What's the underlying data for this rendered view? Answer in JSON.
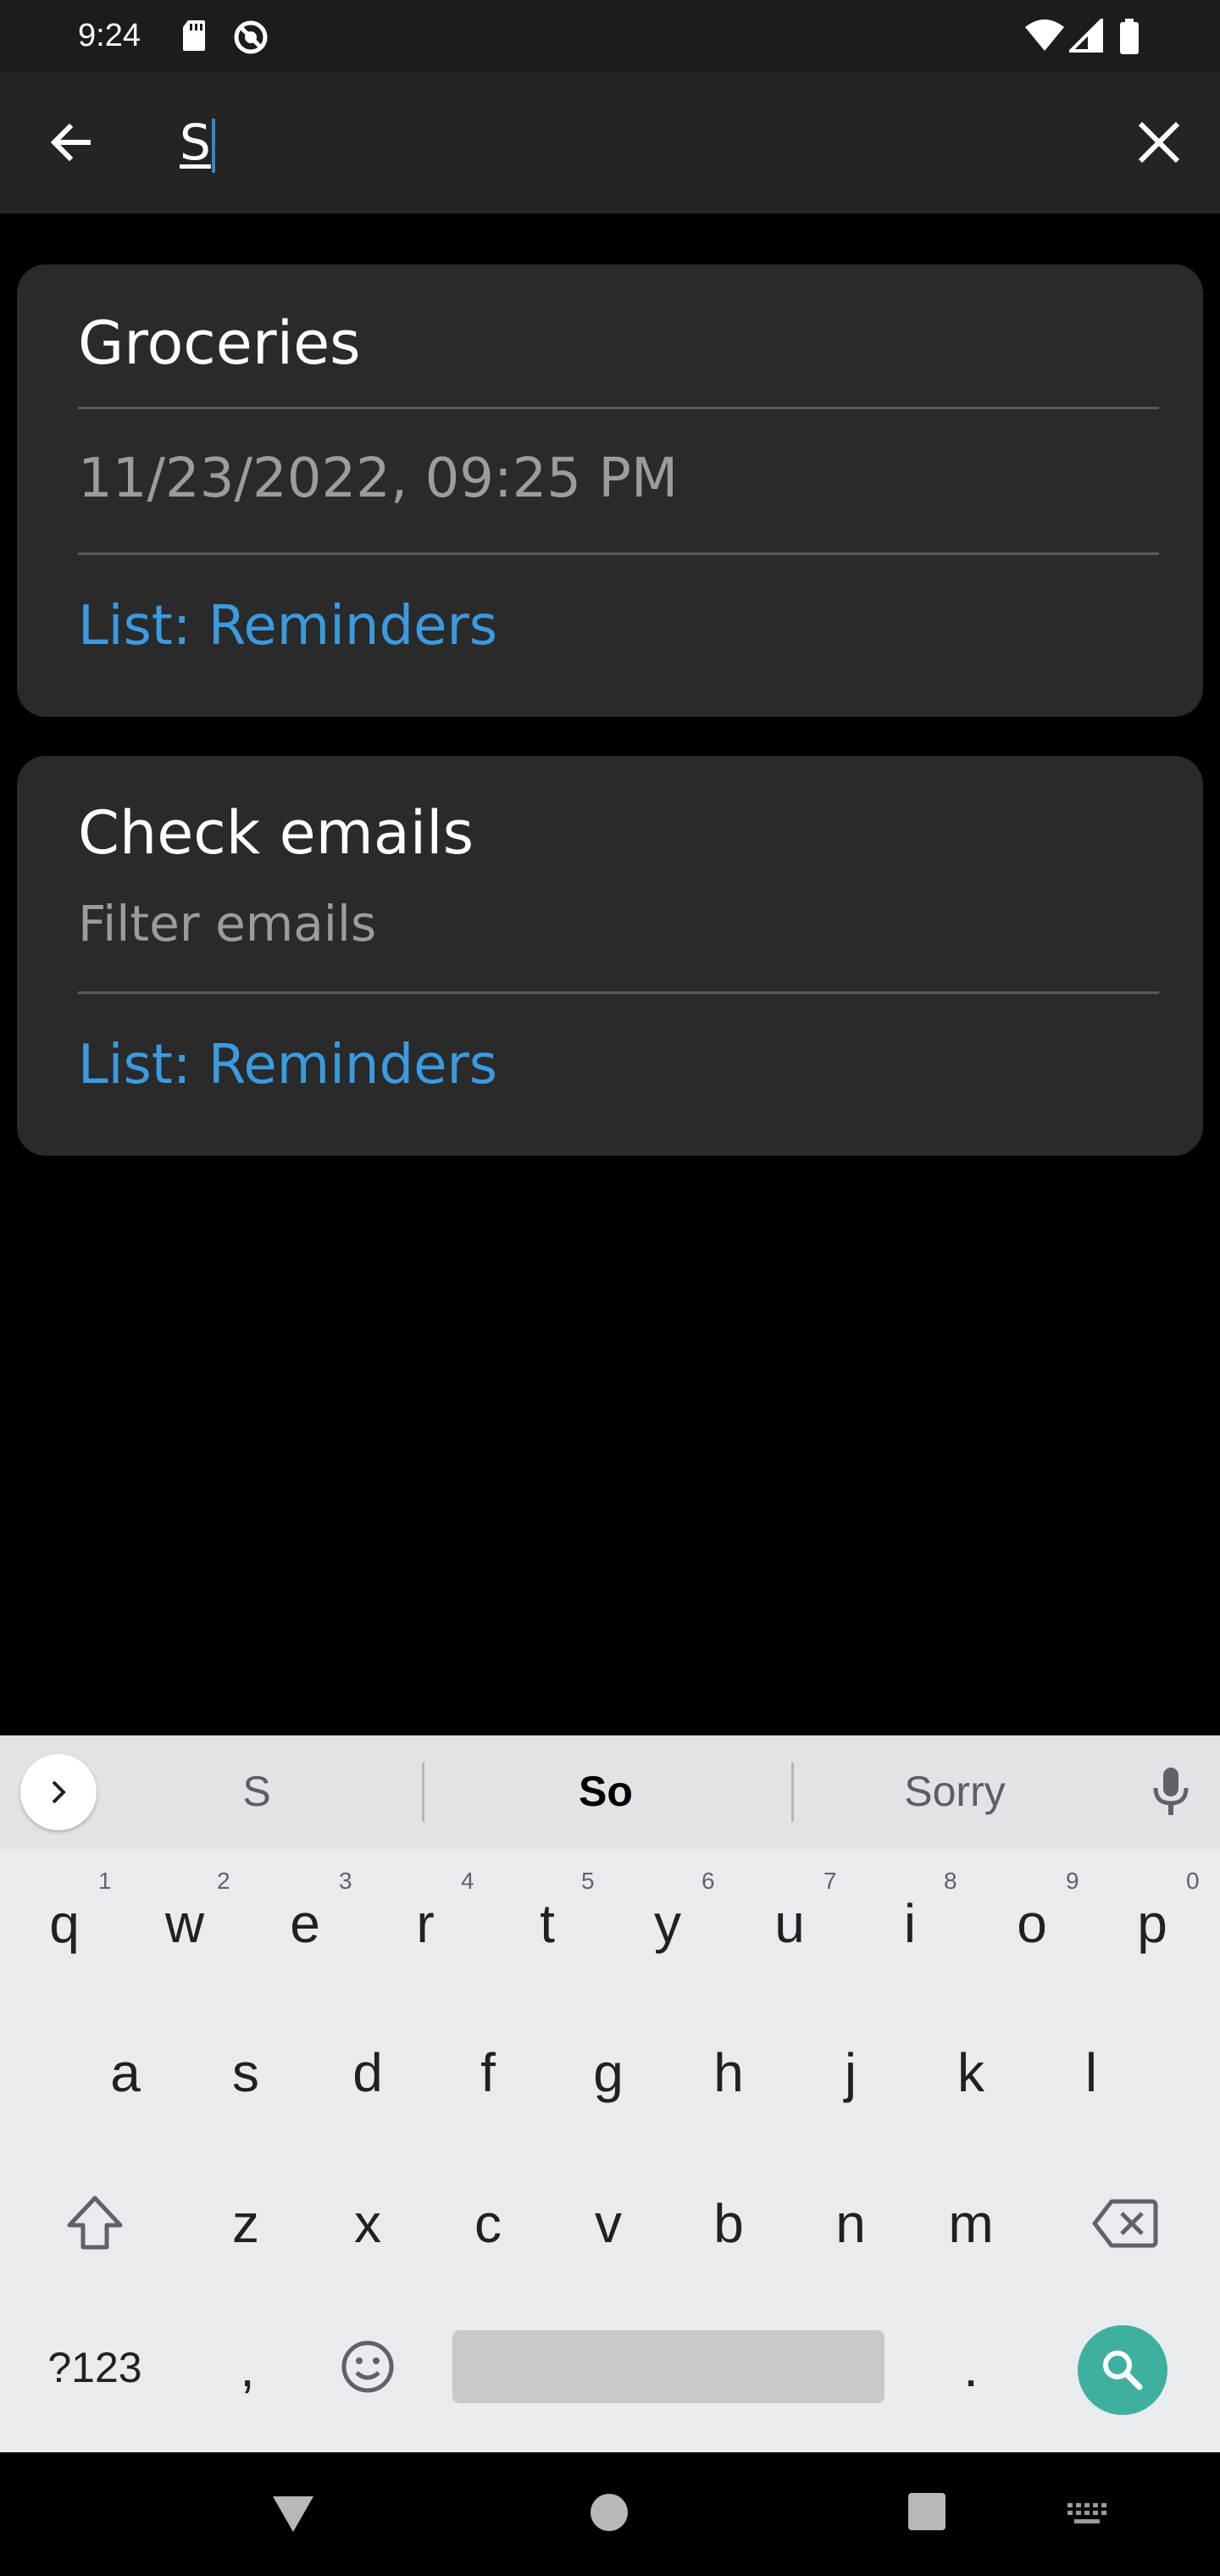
{
  "status": {
    "time": "9:24",
    "left_icons": [
      "sd-card-icon",
      "vpn-circle-icon"
    ],
    "right_icons": [
      "wifi-icon",
      "signal-icon",
      "battery-icon"
    ]
  },
  "search": {
    "value": "S",
    "back_icon": "arrow-left-icon",
    "clear_icon": "close-icon"
  },
  "results": [
    {
      "title": "Groceries",
      "date": "11/23/2022, 09:25 PM",
      "list": "List: Reminders"
    },
    {
      "title": "Check emails",
      "subtitle": "Filter emails",
      "list": "List: Reminders"
    }
  ],
  "keyboard": {
    "suggestions": [
      "S",
      "So",
      "Sorry"
    ],
    "row1": [
      "q",
      "w",
      "e",
      "r",
      "t",
      "y",
      "u",
      "i",
      "o",
      "p"
    ],
    "row1_hints": [
      "1",
      "2",
      "3",
      "4",
      "5",
      "6",
      "7",
      "8",
      "9",
      "0"
    ],
    "row2": [
      "a",
      "s",
      "d",
      "f",
      "g",
      "h",
      "j",
      "k",
      "l"
    ],
    "row3": [
      "z",
      "x",
      "c",
      "v",
      "b",
      "n",
      "m"
    ],
    "symbols": "?123",
    "comma": ",",
    "period": ".",
    "accent": "#3fb0a0"
  },
  "nav": {
    "icons": [
      "back-triangle-icon",
      "home-circle-icon",
      "recents-square-icon",
      "keyboard-switch-icon"
    ]
  }
}
